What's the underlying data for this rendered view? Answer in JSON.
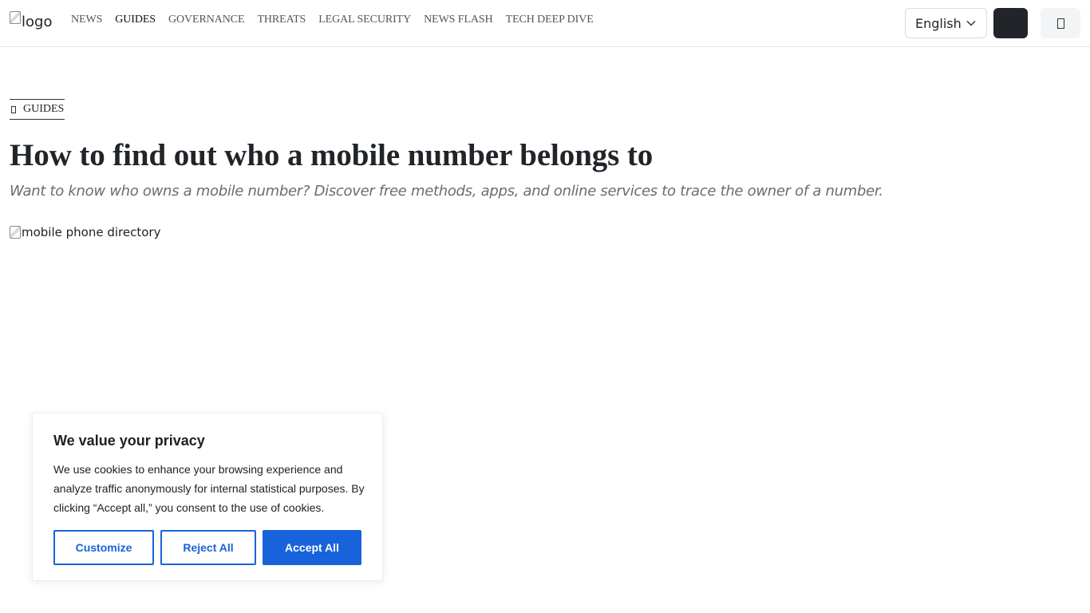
{
  "header": {
    "logo_alt": "logo",
    "nav": [
      {
        "label": "NEWS",
        "active": false
      },
      {
        "label": "GUIDES",
        "active": true
      },
      {
        "label": "GOVERNANCE",
        "active": false
      },
      {
        "label": "THREATS",
        "active": false
      },
      {
        "label": "LEGAL SECURITY",
        "active": false
      },
      {
        "label": "NEWS FLASH",
        "active": false
      },
      {
        "label": "TECH DEEP DIVE",
        "active": false
      }
    ],
    "language": {
      "selected": "English",
      "icon": "chevron-down-icon"
    },
    "theme_button_color": "#212529"
  },
  "article": {
    "category": "GUIDES",
    "title": "How to find out who a mobile number belongs to",
    "subtitle": "Want to know who owns a mobile number? Discover free methods, apps, and online services to trace the owner of a number.",
    "image_alt": "mobile phone directory"
  },
  "cookie_banner": {
    "title": "We value your privacy",
    "text": "We use cookies to enhance your browsing experience and analyze traffic anonymously for internal statistical purposes. By clicking “Accept all,” you consent to the use of cookies.",
    "customize_label": "Customize",
    "reject_label": "Reject All",
    "accept_label": "Accept All",
    "accent_color": "#1863dc"
  }
}
